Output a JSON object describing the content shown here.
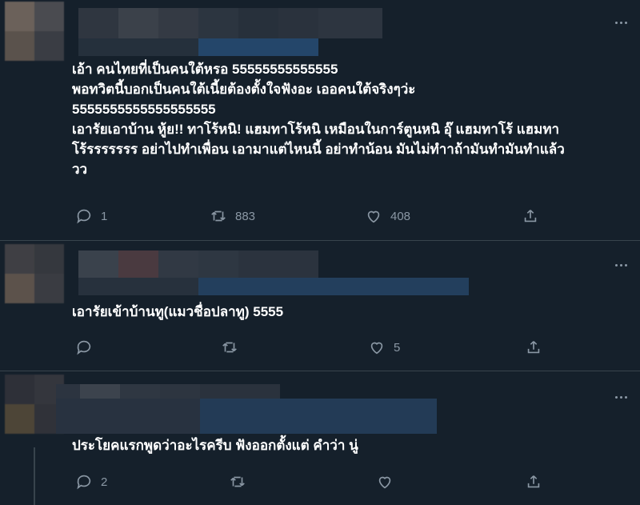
{
  "tweets": [
    {
      "text": "เอ้า คนไทยที่เป็นคนใต้หรอ 55555555555555\nพอทวิตนี้บอกเป็นคนใต้เนี้ยต้องตั้งใจฟังอะ เออคนใต้จริงๆว่ะ\n5555555555555555555\nเอารัยเอาบ้าน หู้ย!! ทาโร้หนิ! แฮมทาโร้หนิ เหมือนในการ์ตูนหนิ อุ๊ แฮมทาโร้ แฮมทา\nโร้รรรรรรร อย่าไปทำเพื่อน เอามาแต่ไหนนี้ อย่าทำน้อน มันไม่ทำาถ้ามันทำมันทำแล้ว\nวว",
      "replies": "1",
      "retweets": "883",
      "likes": "408"
    },
    {
      "text": "เอารัยเข้าบ้านทู(แมวชื่อปลาทู) 5555",
      "replies": "",
      "retweets": "",
      "likes": "5"
    },
    {
      "text": "ประโยคแรกพูดว่าอะไรครีบ ฟังออกตั้งแต่ คำว่า นู่",
      "replies": "2",
      "retweets": "",
      "likes": ""
    }
  ],
  "colors": {
    "background": "#15202b",
    "divider": "#38444d",
    "icon": "#8b98a5",
    "text": "#ffffff"
  },
  "icons": [
    "reply-icon",
    "retweet-icon",
    "like-icon",
    "share-icon",
    "more-icon"
  ]
}
